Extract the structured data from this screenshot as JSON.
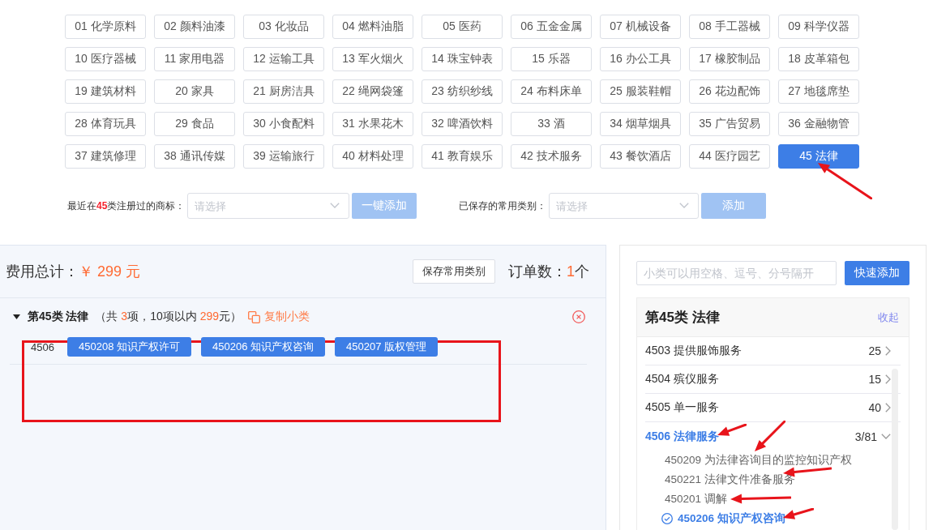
{
  "categories": [
    {
      "label": "01 化学原料",
      "selected": false
    },
    {
      "label": "02 颜料油漆",
      "selected": false
    },
    {
      "label": "03 化妆品",
      "selected": false
    },
    {
      "label": "04 燃料油脂",
      "selected": false
    },
    {
      "label": "05 医药",
      "selected": false
    },
    {
      "label": "06 五金金属",
      "selected": false
    },
    {
      "label": "07 机械设备",
      "selected": false
    },
    {
      "label": "08 手工器械",
      "selected": false
    },
    {
      "label": "09 科学仪器",
      "selected": false
    },
    {
      "label": "10 医疗器械",
      "selected": false
    },
    {
      "label": "11 家用电器",
      "selected": false
    },
    {
      "label": "12 运输工具",
      "selected": false
    },
    {
      "label": "13 军火烟火",
      "selected": false
    },
    {
      "label": "14 珠宝钟表",
      "selected": false
    },
    {
      "label": "15 乐器",
      "selected": false
    },
    {
      "label": "16 办公工具",
      "selected": false
    },
    {
      "label": "17 橡胶制品",
      "selected": false
    },
    {
      "label": "18 皮革箱包",
      "selected": false
    },
    {
      "label": "19 建筑材料",
      "selected": false
    },
    {
      "label": "20 家具",
      "selected": false
    },
    {
      "label": "21 厨房洁具",
      "selected": false
    },
    {
      "label": "22 绳网袋篷",
      "selected": false
    },
    {
      "label": "23 纺织纱线",
      "selected": false
    },
    {
      "label": "24 布料床单",
      "selected": false
    },
    {
      "label": "25 服装鞋帽",
      "selected": false
    },
    {
      "label": "26 花边配饰",
      "selected": false
    },
    {
      "label": "27 地毯席垫",
      "selected": false
    },
    {
      "label": "28 体育玩具",
      "selected": false
    },
    {
      "label": "29 食品",
      "selected": false
    },
    {
      "label": "30 小食配料",
      "selected": false
    },
    {
      "label": "31 水果花木",
      "selected": false
    },
    {
      "label": "32 啤酒饮料",
      "selected": false
    },
    {
      "label": "33 酒",
      "selected": false
    },
    {
      "label": "34 烟草烟具",
      "selected": false
    },
    {
      "label": "35 广告贸易",
      "selected": false
    },
    {
      "label": "36 金融物管",
      "selected": false
    },
    {
      "label": "37 建筑修理",
      "selected": false
    },
    {
      "label": "38 通讯传媒",
      "selected": false
    },
    {
      "label": "39 运输旅行",
      "selected": false
    },
    {
      "label": "40 材料处理",
      "selected": false
    },
    {
      "label": "41 教育娱乐",
      "selected": false
    },
    {
      "label": "42 技术服务",
      "selected": false
    },
    {
      "label": "43 餐饮酒店",
      "selected": false
    },
    {
      "label": "44 医疗园艺",
      "selected": false
    },
    {
      "label": "45 法律",
      "selected": true
    }
  ],
  "filters": [
    {
      "label": [
        {
          "text": "最近在",
          "kind": "plain"
        },
        {
          "text": "45",
          "kind": "highlight"
        },
        {
          "text": "类注册过的商标：",
          "kind": "plain"
        }
      ],
      "select": {
        "placeholder": "请选择"
      },
      "button": {
        "label": "一键添加",
        "disabled": true
      }
    },
    {
      "label": [
        {
          "text": "已保存的常用类别：",
          "kind": "plain"
        }
      ],
      "select": {
        "placeholder": "请选择"
      },
      "button": {
        "label": "添加",
        "disabled": true
      }
    }
  ],
  "order_summary": {
    "total": [
      {
        "text": "费用总计：",
        "kind": "plain"
      },
      {
        "text": "￥ 299 元",
        "kind": "accent"
      }
    ],
    "save_button": "保存常用类别",
    "orders": [
      {
        "text": "订单数：",
        "kind": "plain"
      },
      {
        "text": "1",
        "kind": "accent"
      },
      {
        "text": "个",
        "kind": "plain"
      }
    ]
  },
  "class_groups": [
    {
      "title": "第45类 法律",
      "expanded": true,
      "info": [
        {
          "text": "（共 ",
          "kind": "plain"
        },
        {
          "text": "3",
          "kind": "accent"
        },
        {
          "text": "项，10项以内 ",
          "kind": "plain"
        },
        {
          "text": "299",
          "kind": "accent"
        },
        {
          "text": "元）",
          "kind": "plain"
        }
      ],
      "copy_link": "复制小类",
      "subclasses": [
        {
          "code": "4506",
          "items": [
            "450208 知识产权许可",
            "450206 知识产权咨询",
            "450207 版权管理"
          ]
        }
      ]
    }
  ],
  "quick_add": {
    "placeholder": "小类可以用空格、逗号、分号隔开",
    "button": "快速添加"
  },
  "class_panel": {
    "title": "第45类 法律",
    "collapse_link": "收起",
    "groups": [
      {
        "label": "4503 提供服饰服务",
        "count": "25",
        "expanded": false
      },
      {
        "label": "4504 殡仪服务",
        "count": "15",
        "expanded": false
      },
      {
        "label": "4505 单一服务",
        "count": "40",
        "expanded": false
      },
      {
        "label": "4506 法律服务",
        "count": "3/81",
        "expanded": true,
        "children": [
          {
            "label": "450209 为法律咨询目的监控知识产权",
            "selected": false
          },
          {
            "label": "450221 法律文件准备服务",
            "selected": false
          },
          {
            "label": "450201 调解",
            "selected": false
          },
          {
            "label": "450206 知识产权咨询",
            "selected": true
          }
        ]
      }
    ]
  },
  "annotations": [
    {
      "kind": "arrow"
    },
    {
      "kind": "frame"
    },
    {
      "kind": "arrow"
    },
    {
      "kind": "arrow"
    },
    {
      "kind": "arrow"
    },
    {
      "kind": "arrow"
    },
    {
      "kind": "arrow"
    }
  ]
}
